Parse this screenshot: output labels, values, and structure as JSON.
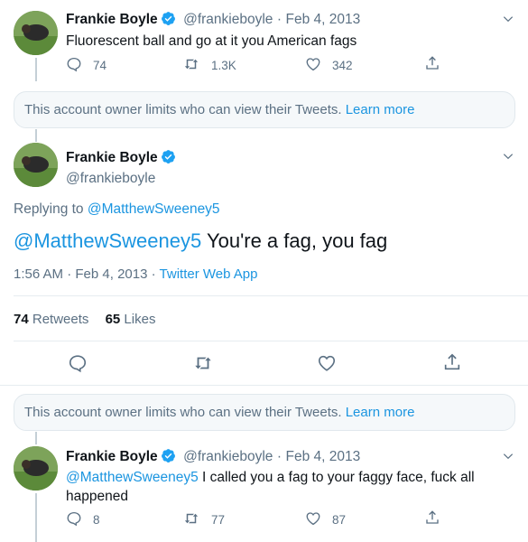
{
  "tweet1": {
    "name": "Frankie Boyle",
    "handle": "@frankieboyle",
    "dot": "·",
    "date": "Feb 4, 2013",
    "text": "Fluorescent ball and go at it you American fags",
    "replies": "74",
    "retweets": "1.3K",
    "likes": "342"
  },
  "notice1": {
    "text": "This account owner limits who can view their Tweets.",
    "link": "Learn more"
  },
  "main": {
    "name": "Frankie Boyle",
    "handle": "@frankieboyle",
    "replying_prefix": "Replying to",
    "replying_to": "@MatthewSweeney5",
    "mention": "@MatthewSweeney5",
    "text": "You're a fag, you fag",
    "time": "1:56 AM",
    "dot1": "·",
    "date": "Feb 4, 2013",
    "dot2": "·",
    "source": "Twitter Web App",
    "retweets_count": "74",
    "retweets_label": "Retweets",
    "likes_count": "65",
    "likes_label": "Likes"
  },
  "notice2": {
    "text": "This account owner limits who can view their Tweets.",
    "link": "Learn more"
  },
  "tweet3": {
    "name": "Frankie Boyle",
    "handle": "@frankieboyle",
    "dot": "·",
    "date": "Feb 4, 2013",
    "mention": "@MatthewSweeney5",
    "text_line1": "I called you a fag to your faggy face, fuck all",
    "text_line2": "happened",
    "replies": "8",
    "retweets": "77",
    "likes": "87"
  },
  "colors": {
    "link": "#1b95e0",
    "verified": "#1da1f2",
    "muted": "#5b7083"
  }
}
